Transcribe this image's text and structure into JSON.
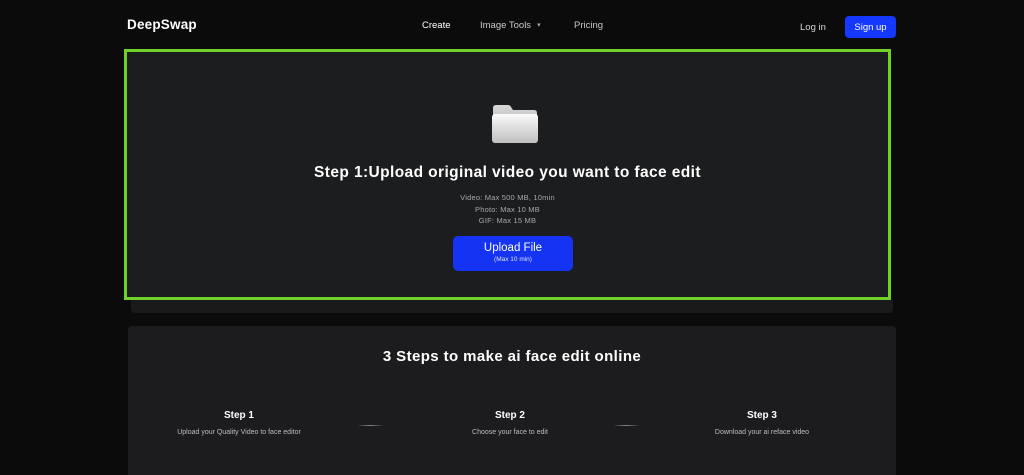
{
  "header": {
    "logo": "DeepSwap",
    "nav": {
      "create": "Create",
      "image_tools": "Image Tools",
      "pricing": "Pricing"
    },
    "login": "Log in",
    "signup": "Sign up"
  },
  "upload": {
    "title": "Step 1:Upload original video you want to face edit",
    "limits": {
      "video": "Video: Max 500 MB, 10min",
      "photo": "Photo: Max 10 MB",
      "gif": "GIF: Max 15 MB"
    },
    "button_label": "Upload File",
    "button_sub": "(Max 10 min)",
    "highlight_color": "#6fd12a"
  },
  "steps": {
    "title": "3 Steps to make ai face edit online",
    "items": [
      {
        "heading": "Step 1",
        "desc": "Upload your Quality Video to face editor"
      },
      {
        "heading": "Step 2",
        "desc": "Choose your face to edit"
      },
      {
        "heading": "Step 3",
        "desc": "Download your ai reface video"
      }
    ]
  },
  "colors": {
    "accent": "#1538ff",
    "background": "#0b0b0b",
    "panel": "#1c1d1f"
  }
}
